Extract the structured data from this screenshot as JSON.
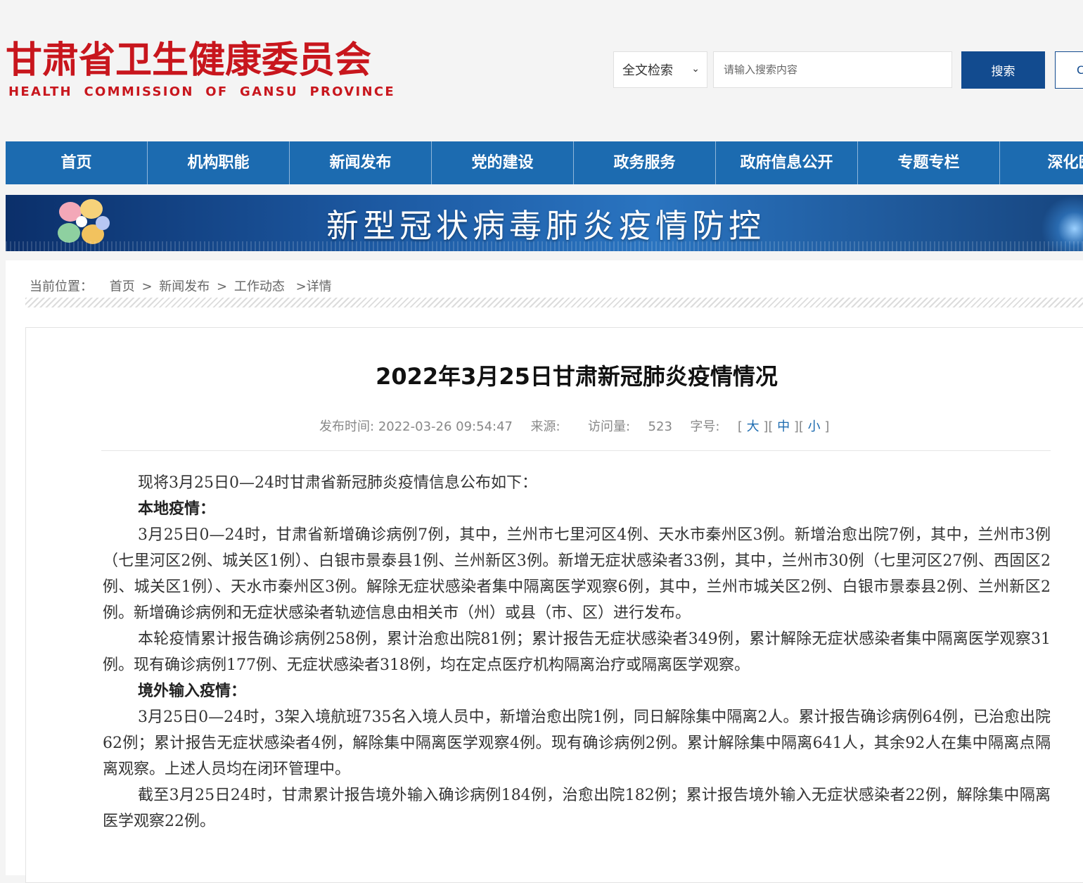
{
  "header": {
    "logo_cn": "甘肃省卫生健康委员会",
    "logo_en": "HEALTH COMMISSION OF GANSU PROVINCE",
    "search": {
      "scope_selected": "全文检索",
      "placeholder": "请输入搜索内容",
      "button_label": "搜索",
      "extra_button_label": "C"
    }
  },
  "nav": {
    "items": [
      "首页",
      "机构职能",
      "新闻发布",
      "党的建设",
      "政务服务",
      "政府信息公开",
      "专题专栏",
      "深化医"
    ]
  },
  "banner": {
    "text": "新型冠状病毒肺炎疫情防控"
  },
  "breadcrumb": {
    "label": "当前位置：",
    "items": [
      "首页",
      ">",
      "新闻发布",
      ">",
      "工作动态",
      ">详情"
    ]
  },
  "article": {
    "title": "2022年3月25日甘肃新冠肺炎疫情情况",
    "meta": {
      "publish_label": "发布时间:",
      "publish_time": "2022-03-26 09:54:47",
      "source_label": "来源:",
      "views_label": "访问量:",
      "views": "523",
      "font_label": "字号:",
      "size_large": "大",
      "size_medium": "中",
      "size_small": "小"
    },
    "paragraphs": [
      {
        "type": "text",
        "text": "现将3月25日0—24时甘肃省新冠肺炎疫情信息公布如下："
      },
      {
        "type": "sub",
        "text": "本地疫情："
      },
      {
        "type": "text",
        "text": "3月25日0—24时，甘肃省新增确诊病例7例，其中，兰州市七里河区4例、天水市秦州区3例。新增治愈出院7例，其中，兰州市3例（七里河区2例、城关区1例）、白银市景泰县1例、兰州新区3例。新增无症状感染者33例，其中，兰州市30例（七里河区27例、西固区2例、城关区1例）、天水市秦州区3例。解除无症状感染者集中隔离医学观察6例，其中，兰州市城关区2例、白银市景泰县2例、兰州新区2例。新增确诊病例和无症状感染者轨迹信息由相关市（州）或县（市、区）进行发布。"
      },
      {
        "type": "text",
        "text": "本轮疫情累计报告确诊病例258例，累计治愈出院81例；累计报告无症状感染者349例，累计解除无症状感染者集中隔离医学观察31例。现有确诊病例177例、无症状感染者318例，均在定点医疗机构隔离治疗或隔离医学观察。"
      },
      {
        "type": "sub",
        "text": "境外输入疫情："
      },
      {
        "type": "text",
        "text": "3月25日0—24时，3架入境航班735名入境人员中，新增治愈出院1例，同日解除集中隔离2人。累计报告确诊病例64例，已治愈出院62例；累计报告无症状感染者4例，解除集中隔离医学观察4例。现有确诊病例2例。累计解除集中隔离641人，其余92人在集中隔离点隔离观察。上述人员均在闭环管理中。"
      },
      {
        "type": "text",
        "text": "截至3月25日24时，甘肃累计报告境外输入确诊病例184例，治愈出院182例；累计报告境外输入无症状感染者22例，解除集中隔离医学观察22例。"
      }
    ]
  },
  "colors": {
    "brand_red": "#c8161d",
    "nav_blue": "#1c6bb0",
    "search_button": "#124b8f"
  }
}
